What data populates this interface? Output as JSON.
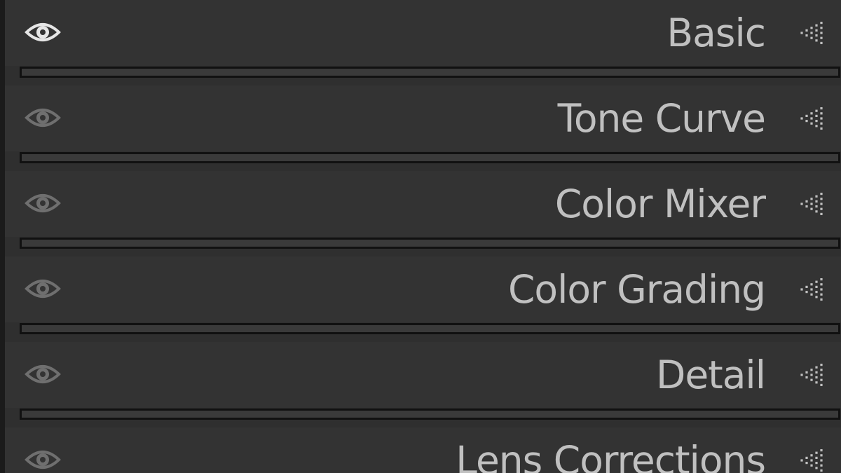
{
  "panels": [
    {
      "label": "Basic",
      "visible": true,
      "eye_icon": "eye-icon",
      "toggle_icon": "disclosure-triangle-icon"
    },
    {
      "label": "Tone Curve",
      "visible": false,
      "eye_icon": "eye-icon",
      "toggle_icon": "disclosure-triangle-icon"
    },
    {
      "label": "Color Mixer",
      "visible": false,
      "eye_icon": "eye-icon",
      "toggle_icon": "disclosure-triangle-icon"
    },
    {
      "label": "Color Grading",
      "visible": false,
      "eye_icon": "eye-icon",
      "toggle_icon": "disclosure-triangle-icon"
    },
    {
      "label": "Detail",
      "visible": false,
      "eye_icon": "eye-icon",
      "toggle_icon": "disclosure-triangle-icon"
    },
    {
      "label": "Lens Corrections",
      "visible": false,
      "eye_icon": "eye-icon",
      "toggle_icon": "disclosure-triangle-icon"
    }
  ],
  "colors": {
    "background": "#333333",
    "label": "#c0c0c0",
    "eye_active": "#e6e6e6",
    "eye_inactive": "#6f6f6f",
    "divider_border": "#111111"
  }
}
